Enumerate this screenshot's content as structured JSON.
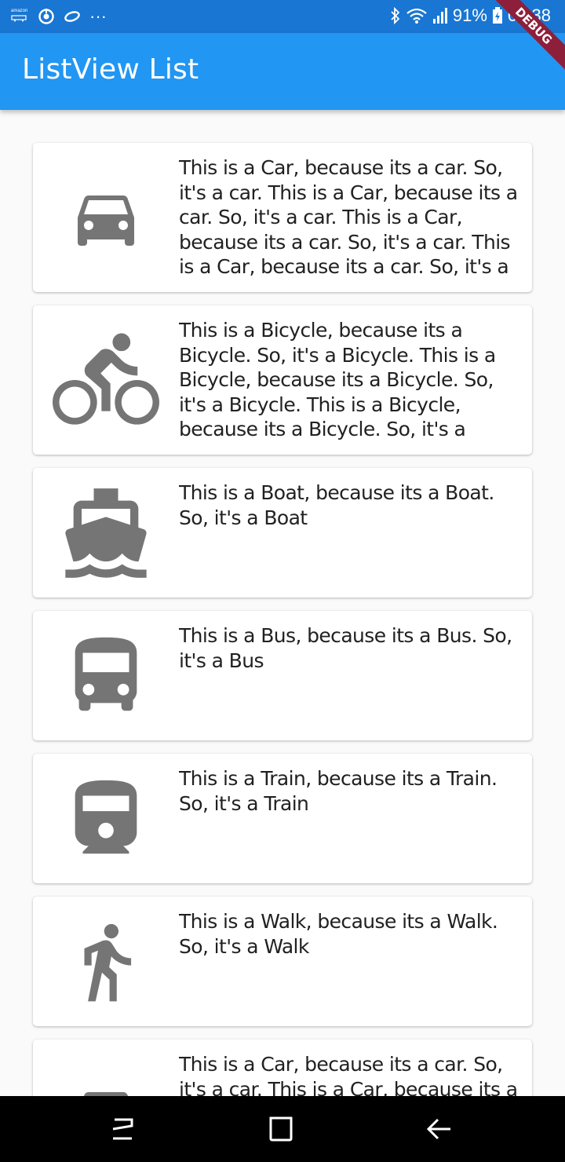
{
  "status_bar": {
    "amazon_label": "amazon",
    "more": "···",
    "battery": "91%",
    "time": "07:38",
    "bluetooth_icon": "bluetooth-icon",
    "wifi_icon": "wifi-icon",
    "signal_icon": "signal-icon",
    "battery_icon": "battery-icon"
  },
  "app_bar": {
    "title": "ListView List",
    "color": "#2196f3"
  },
  "debug_banner": "DEBUG",
  "items": [
    {
      "icon": "car-icon",
      "text": "This is a Car, because its a car. So, it's a car. This is a Car, because its a car. So, it's a car. This is a Car, because its a car. So, it's a car. This is a Car, because its a car. So, it's a"
    },
    {
      "icon": "bicycle-icon",
      "text": "This is a Bicycle, because its a Bicycle. So, it's a Bicycle. This is a Bicycle, because its a Bicycle. So, it's a Bicycle. This is a Bicycle, because its a Bicycle. So, it's a"
    },
    {
      "icon": "boat-icon",
      "text": "This is a Boat, because its a Boat. So, it's a Boat"
    },
    {
      "icon": "bus-icon",
      "text": "This is a Bus, because its a Bus. So, it's a Bus"
    },
    {
      "icon": "train-icon",
      "text": "This is a Train, because its a Train. So, it's a Train"
    },
    {
      "icon": "walk-icon",
      "text": "This is a Walk, because its a Walk. So, it's a Walk"
    },
    {
      "icon": "car-icon",
      "text": "This is a Car, because its a car. So, it's a car. This is a Car, because its a car. So, it's a car. This is a Car, because its a car. So, it's a car. This is a Car, because its a car. So, it's a"
    }
  ],
  "nav_bar": {
    "recents_icon": "recents-icon",
    "home_icon": "home-icon",
    "back_icon": "back-icon"
  }
}
